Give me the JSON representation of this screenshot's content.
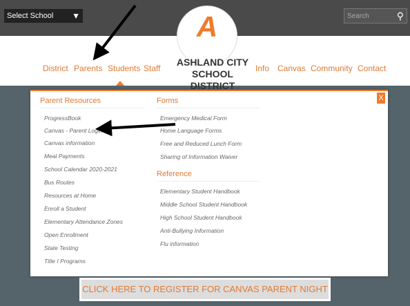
{
  "topbar": {
    "select_label": "Select School",
    "search_placeholder": "Search"
  },
  "nav": {
    "items": [
      "District",
      "Parents",
      "Students",
      "Staff",
      "Info",
      "Canvas",
      "Community",
      "Contact"
    ],
    "school_line1": "ASHLAND CITY",
    "school_line2": "SCHOOL DISTRICT"
  },
  "dropdown": {
    "parent_resources": {
      "heading": "Parent Resources",
      "links": [
        "ProgressBook",
        "Canvas - Parent Login",
        "Canvas information",
        "Meal Payments",
        "School Calendar 2020-2021",
        "Bus Routes",
        "Resources at Home",
        "Enroll a Student",
        "Elementary Attendance Zones",
        "Open Enrollment",
        "State Testing",
        "Title I Programs"
      ]
    },
    "forms": {
      "heading": "Forms",
      "links": [
        "Emergency Medical Form",
        "Home Language Forms",
        "Free and Reduced Lunch Form",
        "Sharing of Information Waiver"
      ]
    },
    "reference": {
      "heading": "Reference",
      "links": [
        "Elementary Student Handbook",
        "Middle School Student Handbook",
        "High School Student Handbook",
        "Anti-Bullying Information",
        "Flu information"
      ]
    },
    "close_label": "X"
  },
  "hero": {
    "banner": "CLICK HERE TO REGISTER FOR CANVAS PARENT NIGHT"
  },
  "colors": {
    "accent": "#f07b2a",
    "topbar": "#4a4a4a"
  }
}
